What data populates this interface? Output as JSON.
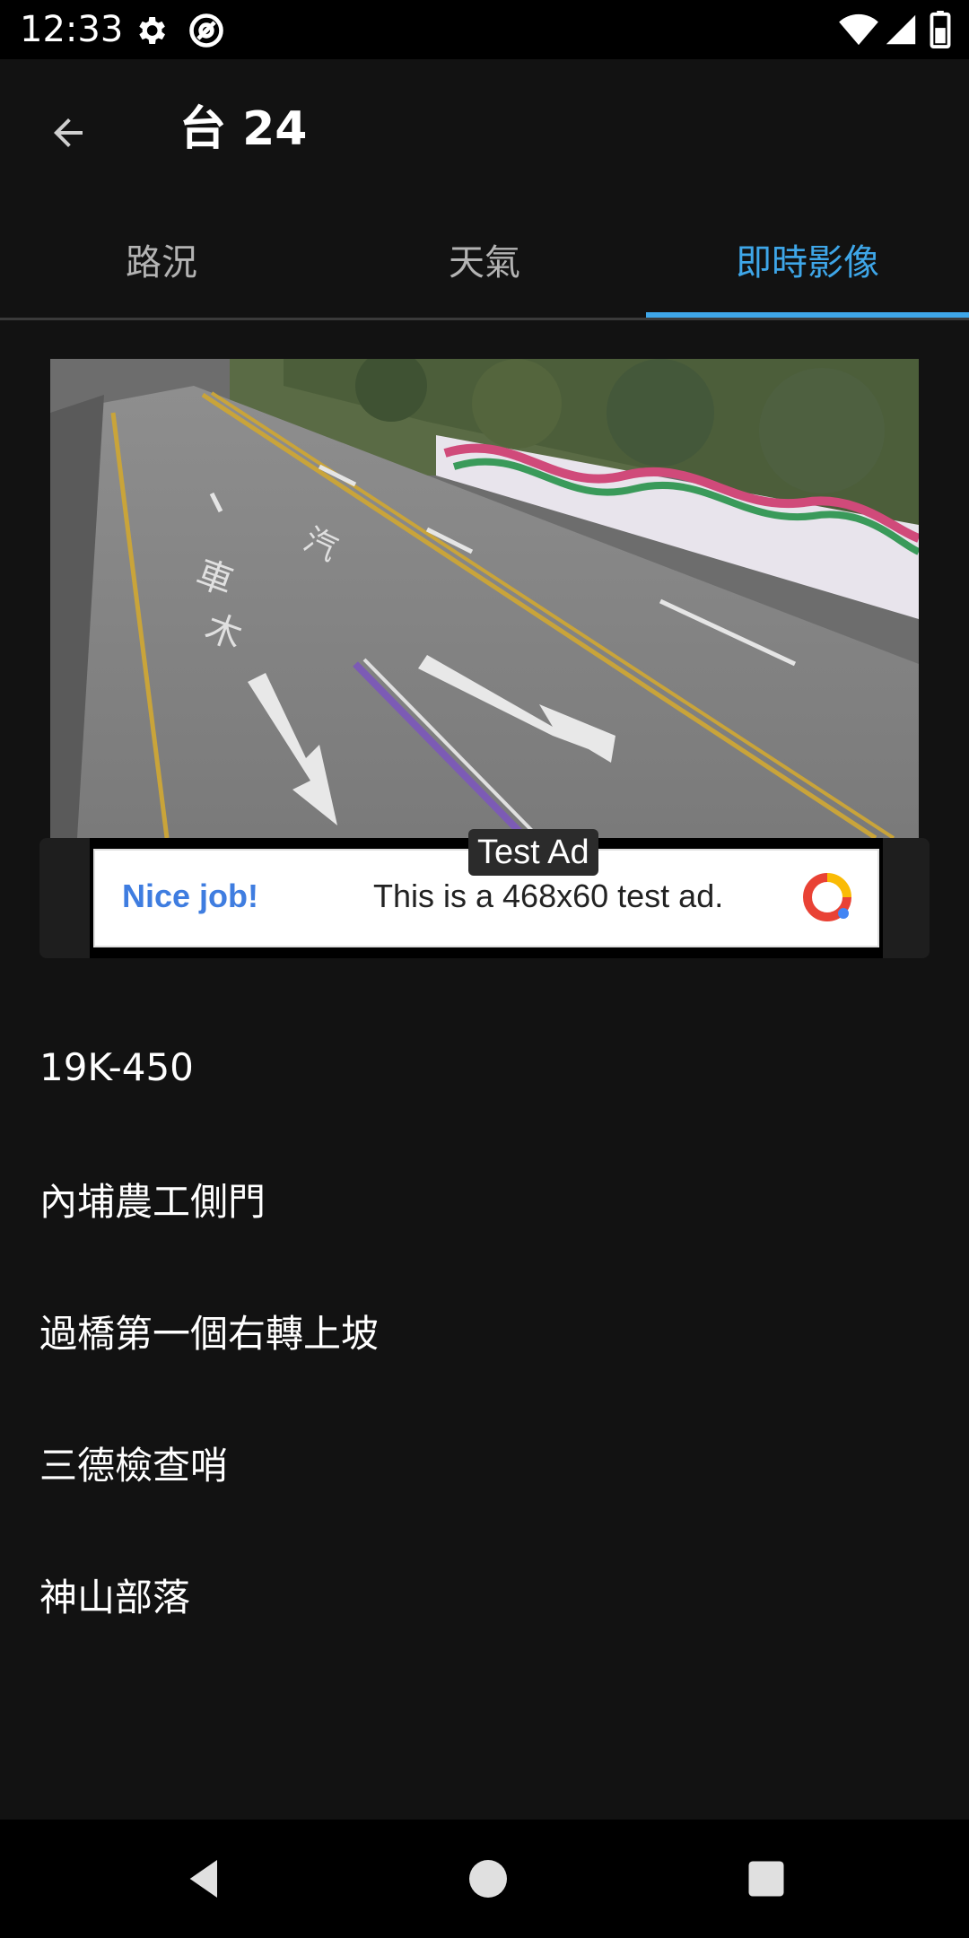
{
  "status_bar": {
    "time": "12:33"
  },
  "app_bar": {
    "title": "台 24",
    "back_icon": "arrow-back-icon"
  },
  "tabs": [
    {
      "label": "路況",
      "active": false
    },
    {
      "label": "天氣",
      "active": false
    },
    {
      "label": "即時影像",
      "active": true
    }
  ],
  "camera_feed": {
    "description_icon": "live-camera-image"
  },
  "ad": {
    "label": "Test Ad",
    "headline": "Nice job!",
    "body": "This is a 468x60 test ad."
  },
  "camera_list": [
    {
      "name": "19K-450"
    },
    {
      "name": "內埔農工側門"
    },
    {
      "name": "過橋第一個右轉上坡"
    },
    {
      "name": "三德檢查哨"
    },
    {
      "name": "神山部落"
    }
  ],
  "colors": {
    "accent": "#3ea6e8",
    "background": "#121212"
  }
}
